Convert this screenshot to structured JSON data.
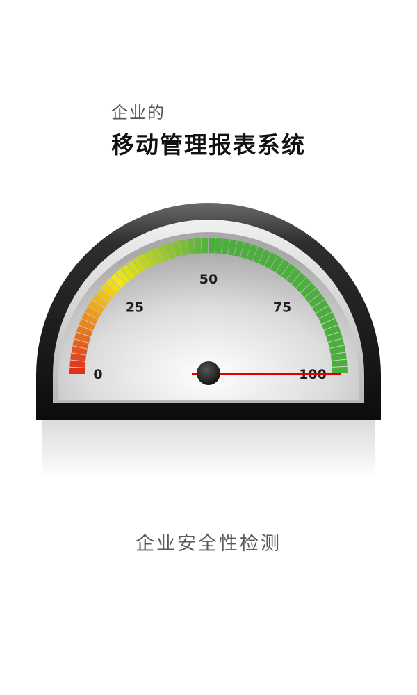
{
  "header": {
    "subtitle": "企业的",
    "title": "移动管理报表系统"
  },
  "gauge": {
    "min": 0,
    "max": 100,
    "value": 100,
    "tick_labels": [
      "0",
      "25",
      "50",
      "75",
      "100"
    ],
    "colors": {
      "low": "#e0301e",
      "mid": "#f2e61c",
      "high": "#4cae3c",
      "needle": "#e00000",
      "bezel": "#1a1a1a"
    }
  },
  "footer": {
    "caption": "企业安全性检测"
  }
}
